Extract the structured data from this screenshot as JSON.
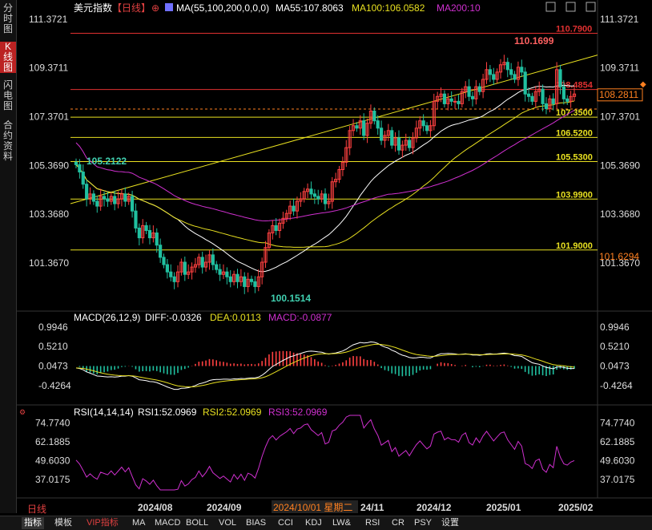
{
  "sidebar": {
    "tabs": [
      "分时图",
      "K线图",
      "闪电图",
      "合约资料"
    ],
    "active": 1
  },
  "header": {
    "instrument": "美元指数",
    "period": "【日线】",
    "ma_params": "MA(55,100,200,0,0,0)",
    "ma55": "MA55:107.8063",
    "ma100": "MA100:106.0582",
    "ma200": "MA200:10"
  },
  "colors": {
    "up": "#ff4040",
    "down": "#20c0a0",
    "ma55": "#ffffff",
    "ma100": "#e8e020",
    "ma200": "#d030d0",
    "hline": "#e8e020",
    "resist": "#e03030",
    "trend": "#e8e020",
    "diff": "#ffffff",
    "dea": "#e8e020",
    "rsi": "#d030d0"
  },
  "chart_data": [
    {
      "type": "candlestick",
      "title": "美元指数【日线】",
      "x_ticks": [
        "2024/08",
        "2024/09",
        "2024/10/01 星期二",
        "24/11",
        "2024/12",
        "2025/01",
        "2025/02"
      ],
      "y_ticks": [
        111.3721,
        109.3711,
        107.3701,
        105.369,
        103.368,
        101.367
      ],
      "ylim": [
        100.0,
        112.0
      ],
      "annotations": {
        "high": "110.1699",
        "low": "100.1514",
        "start": "105.2122",
        "last_price": "108.2811",
        "bottom_price": "101.6294"
      },
      "horizontal_levels": [
        {
          "value": 110.79,
          "label": "110.7900",
          "color": "red"
        },
        {
          "value": 108.4854,
          "label": "108.4854",
          "color": "red"
        },
        {
          "value": 107.35,
          "label": "107.3500",
          "color": "yellow"
        },
        {
          "value": 106.52,
          "label": "106.5200",
          "color": "yellow"
        },
        {
          "value": 105.53,
          "label": "105.5300",
          "color": "yellow"
        },
        {
          "value": 103.99,
          "label": "103.9900",
          "color": "yellow"
        },
        {
          "value": 101.9,
          "label": "101.9000",
          "color": "yellow"
        }
      ],
      "trendline": {
        "from": 103.8,
        "to": 109.9
      },
      "closes": [
        105.4,
        105.1,
        104.6,
        104.0,
        104.2,
        103.9,
        103.7,
        104.1,
        104.0,
        103.9,
        104.1,
        103.8,
        104.0,
        104.2,
        103.9,
        104.1,
        103.5,
        102.8,
        102.4,
        102.9,
        102.7,
        102.4,
        102.6,
        102.1,
        101.6,
        101.3,
        101.0,
        100.8,
        100.6,
        101.0,
        101.4,
        100.9,
        101.0,
        101.2,
        101.3,
        101.6,
        101.2,
        101.4,
        101.7,
        101.3,
        101.1,
        100.9,
        101.0,
        100.8,
        100.6,
        100.9,
        100.6,
        100.8,
        100.4,
        100.7,
        100.6,
        100.4,
        100.8,
        101.4,
        102.0,
        102.6,
        102.9,
        102.7,
        103.0,
        103.2,
        103.4,
        103.7,
        103.5,
        103.9,
        104.0,
        104.3,
        104.4,
        104.2,
        104.1,
        104.0,
        104.2,
        103.8,
        103.9,
        104.7,
        104.8,
        105.2,
        105.5,
        106.1,
        106.8,
        107.0,
        106.9,
        107.2,
        106.6,
        107.1,
        107.6,
        107.2,
        106.9,
        106.4,
        106.6,
        106.8,
        106.2,
        106.5,
        106.0,
        106.2,
        106.4,
        106.1,
        106.5,
        106.9,
        107.2,
        107.0,
        106.8,
        107.0,
        108.0,
        108.2,
        108.3,
        107.9,
        108.1,
        108.0,
        108.0,
        107.9,
        108.4,
        108.6,
        108.2,
        108.1,
        108.6,
        108.4,
        108.9,
        109.3,
        109.1,
        108.9,
        109.2,
        109.5,
        109.6,
        109.3,
        109.1,
        108.9,
        109.4,
        109.2,
        108.3,
        108.2,
        108.0,
        108.4,
        108.5,
        107.9,
        107.7,
        108.1,
        107.9,
        109.3,
        108.6,
        108.1,
        108.0,
        108.2,
        108.3
      ],
      "ma_last": {
        "ma55": 107.8063,
        "ma100": 106.0582
      }
    },
    {
      "type": "macd",
      "title": "MACD(26,12,9)",
      "diff_label": "DIFF:-0.0326",
      "dea_label": "DEA:0.0113",
      "macd_label": "MACD:-0.0877",
      "y_ticks": [
        0.9946,
        0.521,
        0.0473,
        -0.4264
      ],
      "ylim": [
        -0.95,
        1.25
      ]
    },
    {
      "type": "rsi",
      "title": "RSI(14,14,14)",
      "rsi1_label": "RSI1:52.0969",
      "rsi2_label": "RSI2:52.0969",
      "rsi3_label": "RSI3:52.0969",
      "y_ticks": [
        74.774,
        62.1885,
        49.603,
        37.0175
      ],
      "ylim": [
        26,
        83
      ]
    }
  ],
  "footer": {
    "mode": "日线",
    "tabs": [
      "指标",
      "模板",
      "VIP指标",
      "MA",
      "MACD",
      "BOLL",
      "VOL",
      "BIAS",
      "CCI",
      "KDJ",
      "LW&",
      "RSI",
      "CR",
      "PSY",
      "设置"
    ]
  }
}
